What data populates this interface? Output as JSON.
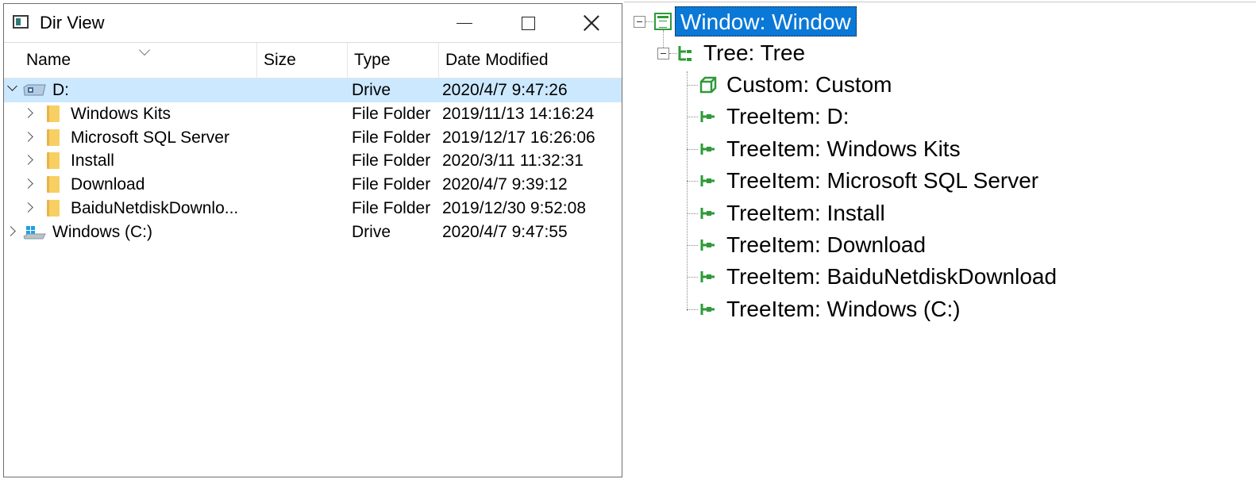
{
  "window": {
    "title": "Dir View",
    "columns": [
      "Name",
      "Size",
      "Type",
      "Date Modified"
    ],
    "rows": [
      {
        "name": "D:",
        "type": "Drive",
        "date": "2020/4/7 9:47:26",
        "level": 0,
        "expanded": true,
        "kind": "drive-d",
        "selected": true
      },
      {
        "name": "Windows Kits",
        "type": "File Folder",
        "date": "2019/11/13 14:16:24",
        "level": 1,
        "expanded": false,
        "kind": "folder"
      },
      {
        "name": "Microsoft SQL Server",
        "type": "File Folder",
        "date": "2019/12/17 16:26:06",
        "level": 1,
        "expanded": false,
        "kind": "folder"
      },
      {
        "name": "Install",
        "type": "File Folder",
        "date": "2020/3/11 11:32:31",
        "level": 1,
        "expanded": false,
        "kind": "folder"
      },
      {
        "name": "Download",
        "type": "File Folder",
        "date": "2020/4/7 9:39:12",
        "level": 1,
        "expanded": false,
        "kind": "folder"
      },
      {
        "name": "BaiduNetdiskDownlo...",
        "type": "File Folder",
        "date": "2019/12/30 9:52:08",
        "level": 1,
        "expanded": false,
        "kind": "folder"
      },
      {
        "name": "Windows  (C:)",
        "type": "Drive",
        "date": "2020/4/7 9:47:55",
        "level": 0,
        "expanded": false,
        "kind": "drive-c"
      }
    ]
  },
  "tree": {
    "root": "Window: Window",
    "tree_node": "Tree: Tree",
    "children": [
      {
        "label": "Custom: Custom",
        "icon": "custom-icon"
      },
      {
        "label": "TreeItem: D:",
        "icon": "tree-item-icon"
      },
      {
        "label": "TreeItem: Windows Kits",
        "icon": "tree-item-icon"
      },
      {
        "label": "TreeItem: Microsoft SQL Server",
        "icon": "tree-item-icon"
      },
      {
        "label": "TreeItem: Install",
        "icon": "tree-item-icon"
      },
      {
        "label": "TreeItem: Download",
        "icon": "tree-item-icon"
      },
      {
        "label": "TreeItem: BaiduNetdiskDownload",
        "icon": "tree-item-icon"
      },
      {
        "label": "TreeItem: Windows  (C:)",
        "icon": "tree-item-icon"
      }
    ]
  },
  "colors": {
    "selection": "#cce8ff",
    "tree_highlight": "#0a78d7",
    "tree_icon_green": "#2e9a3a",
    "folder_yellow": "#f7cf63"
  }
}
